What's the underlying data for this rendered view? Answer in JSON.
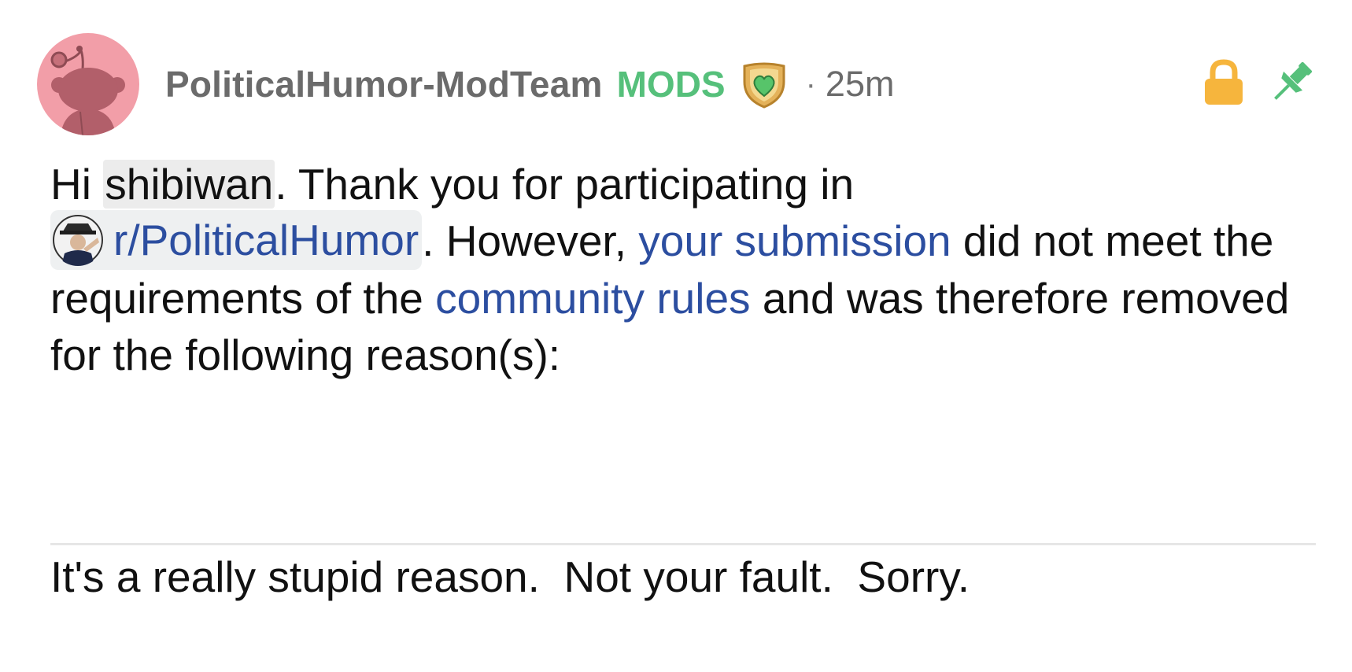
{
  "comment": {
    "author": "PoliticalHumor-ModTeam",
    "mod_badge": "MODS",
    "separator": "·",
    "timestamp": "25m",
    "colors": {
      "avatar_bg": "#f29ea8",
      "mods_green": "#56c07b",
      "link_blue": "#2c4ea0",
      "lock_orange": "#f6b53d",
      "pin_green": "#56c07b"
    },
    "icons": {
      "lock": "lock-icon",
      "pin": "pin-icon",
      "shield": "mod-shield-icon"
    },
    "body": {
      "greeting": "Hi ",
      "mention": "shibiwan",
      "text1": ". Thank you for participating in ",
      "subreddit": "r/PoliticalHumor",
      "text2": ". However, ",
      "link1": "your submission",
      "text3": " did not meet the requirements of the ",
      "link2": "community rules",
      "text4": " and was therefore removed for the following reason(s):"
    },
    "reason": "It's a really stupid reason.  Not your fault.  Sorry."
  }
}
